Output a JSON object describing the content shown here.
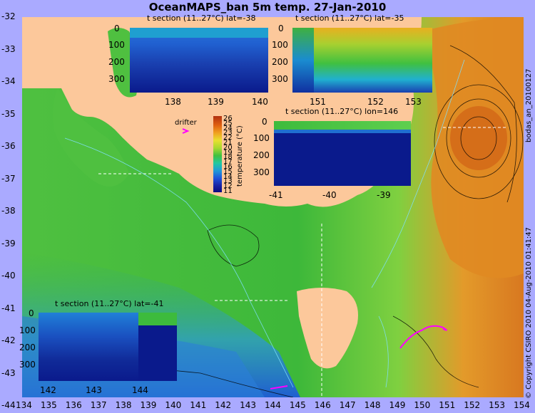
{
  "title": "OceanMAPS_ban 5m temp. 27-Jan-2010",
  "side_right": "bodas_an_20100127",
  "side_right2": "© Copyright CSIRO 2010   04-Aug-2010 01:41:47",
  "axes": {
    "x_ticks": [
      "134",
      "135",
      "136",
      "137",
      "138",
      "139",
      "140",
      "141",
      "142",
      "143",
      "144",
      "145",
      "146",
      "147",
      "148",
      "149",
      "150",
      "151",
      "152",
      "153",
      "154"
    ],
    "y_ticks": [
      "-32",
      "-33",
      "-34",
      "-35",
      "-36",
      "-37",
      "-38",
      "-39",
      "-40",
      "-41",
      "-42",
      "-43",
      "-44"
    ],
    "x_range": [
      134,
      154
    ],
    "y_range": [
      -44,
      -32
    ]
  },
  "drifter_label": "drifter",
  "colorbar": {
    "label": "temperature (°C)",
    "ticks": [
      "26",
      "25",
      "24",
      "23",
      "22",
      "21",
      "20",
      "19",
      "18",
      "17",
      "16",
      "15",
      "14",
      "13",
      "12",
      "11"
    ],
    "range": [
      11,
      26
    ]
  },
  "insets": [
    {
      "title": "t section (11..27°C) lat=-38",
      "y_ticks": [
        "0",
        "100",
        "200",
        "300"
      ],
      "x_ticks": [
        "138",
        "139",
        "140"
      ]
    },
    {
      "title": "t section (11..27°C) lat=-35",
      "y_ticks": [
        "0",
        "100",
        "200",
        "300"
      ],
      "x_ticks": [
        "151",
        "152",
        "153"
      ]
    },
    {
      "title": "t section (11..27°C) lon=146",
      "y_ticks": [
        "0",
        "100",
        "200",
        "300"
      ],
      "x_ticks": [
        "-41",
        "-40",
        "-39"
      ]
    },
    {
      "title": "t section (11..27°C) lat=-41",
      "y_ticks": [
        "0",
        "100",
        "200",
        "300"
      ],
      "x_ticks": [
        "142",
        "143",
        "144"
      ]
    }
  ],
  "colors": {
    "land": "#fcc89b",
    "ocean_warm": "#e07a18",
    "ocean_mid": "#3dbb3d",
    "ocean_cool": "#2878d8",
    "deep": "#0a1a8c",
    "drifter": "#ff00ff",
    "background": "#aaaaff"
  }
}
